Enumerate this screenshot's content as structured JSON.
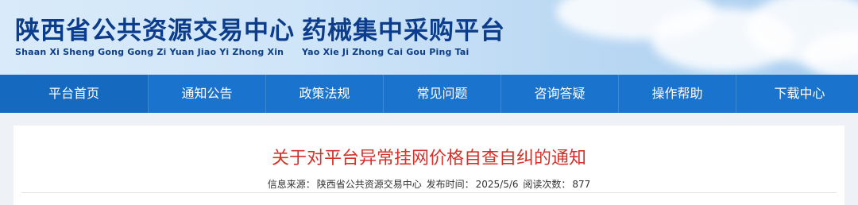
{
  "header": {
    "title_cn_1": "陕西省公共资源交易中心",
    "title_en_1": "Shaan Xi Sheng Gong Gong Zi Yuan Jiao Yi Zhong Xin",
    "title_cn_2": "药械集中采购平台",
    "title_en_2": "Yao Xie Ji Zhong Cai Gou Ping Tai"
  },
  "nav": {
    "items": [
      {
        "label": "平台首页"
      },
      {
        "label": "通知公告"
      },
      {
        "label": "政策法规"
      },
      {
        "label": "常见问题"
      },
      {
        "label": "咨询答疑"
      },
      {
        "label": "操作帮助"
      },
      {
        "label": "下载中心"
      }
    ]
  },
  "article": {
    "title": "关于对平台异常挂网价格自查自纠的通知",
    "meta": {
      "source_label": "信息来源：",
      "source_value": "陕西省公共资源交易中心",
      "date_label": "发布时间：",
      "date_value": "2025/5/6",
      "views_label": "阅读次数：",
      "views_value": "877"
    }
  },
  "colors": {
    "brand_blue": "#0c3d8c",
    "nav_blue": "#1a73cc",
    "title_red": "#d4312a"
  }
}
